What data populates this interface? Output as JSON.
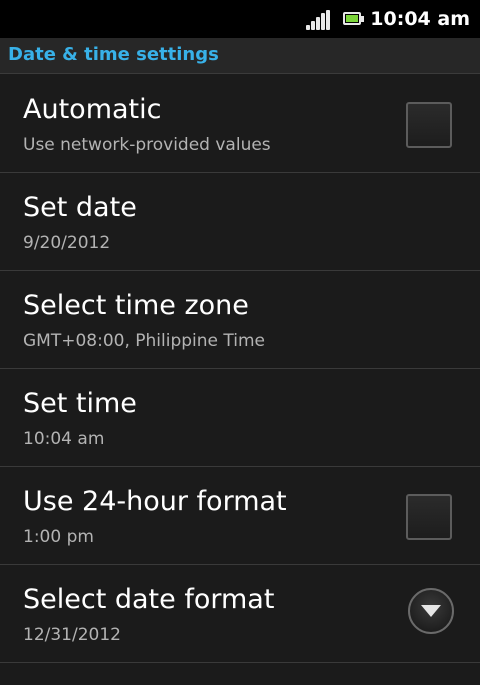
{
  "status_bar": {
    "time": "10:04 am",
    "signal_icon": "signal-strength-icon",
    "battery_icon": "battery-icon",
    "battery_color": "#7cd53a"
  },
  "header": {
    "title": "Date & time settings",
    "title_color": "#38b1e8"
  },
  "settings": [
    {
      "title": "Automatic",
      "subtitle": "Use network-provided values",
      "control": "checkbox",
      "checked": false
    },
    {
      "title": "Set date",
      "subtitle": "9/20/2012",
      "control": "none"
    },
    {
      "title": "Select time zone",
      "subtitle": "GMT+08:00, Philippine Time",
      "control": "none"
    },
    {
      "title": "Set time",
      "subtitle": "10:04 am",
      "control": "none"
    },
    {
      "title": "Use 24-hour format",
      "subtitle": "1:00 pm",
      "control": "checkbox",
      "checked": false
    },
    {
      "title": "Select date format",
      "subtitle": "12/31/2012",
      "control": "dropdown"
    }
  ]
}
